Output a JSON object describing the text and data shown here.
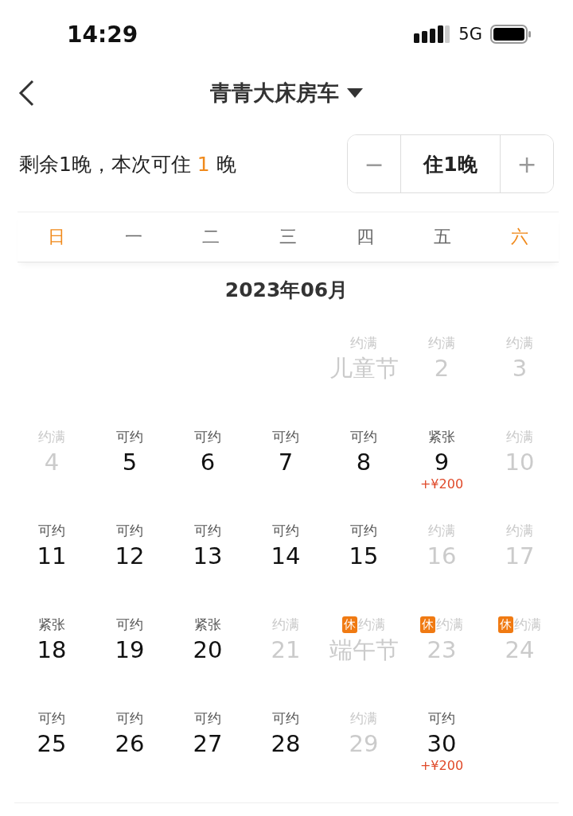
{
  "status_bar": {
    "time": "14:29",
    "network": "5G"
  },
  "nav": {
    "title": "青青大床房车"
  },
  "stay": {
    "prefix": "剩余1晚，本次可住",
    "count": "1",
    "suffix": "晚",
    "minus": "−",
    "value": "住1晚",
    "plus": "+"
  },
  "weekdays": [
    {
      "label": "日",
      "weekend": true
    },
    {
      "label": "一",
      "weekend": false
    },
    {
      "label": "二",
      "weekend": false
    },
    {
      "label": "三",
      "weekend": false
    },
    {
      "label": "四",
      "weekend": false
    },
    {
      "label": "五",
      "weekend": false
    },
    {
      "label": "六",
      "weekend": true
    }
  ],
  "month": {
    "title": "2023年06月",
    "days": [
      {
        "status": "约满",
        "date": "儿童节",
        "full": true
      },
      {
        "status": "约满",
        "date": "2",
        "full": true
      },
      {
        "status": "约满",
        "date": "3",
        "full": true
      },
      {
        "status": "约满",
        "date": "4",
        "full": true
      },
      {
        "status": "可约",
        "date": "5",
        "full": false
      },
      {
        "status": "可约",
        "date": "6",
        "full": false
      },
      {
        "status": "可约",
        "date": "7",
        "full": false
      },
      {
        "status": "可约",
        "date": "8",
        "full": false
      },
      {
        "status": "紧张",
        "date": "9",
        "full": false,
        "price": "+¥200"
      },
      {
        "status": "约满",
        "date": "10",
        "full": true
      },
      {
        "status": "可约",
        "date": "11",
        "full": false
      },
      {
        "status": "可约",
        "date": "12",
        "full": false
      },
      {
        "status": "可约",
        "date": "13",
        "full": false
      },
      {
        "status": "可约",
        "date": "14",
        "full": false
      },
      {
        "status": "可约",
        "date": "15",
        "full": false
      },
      {
        "status": "约满",
        "date": "16",
        "full": true
      },
      {
        "status": "约满",
        "date": "17",
        "full": true
      },
      {
        "status": "紧张",
        "date": "18",
        "full": false
      },
      {
        "status": "可约",
        "date": "19",
        "full": false
      },
      {
        "status": "紧张",
        "date": "20",
        "full": false
      },
      {
        "status": "约满",
        "date": "21",
        "full": true
      },
      {
        "status": "约满",
        "date": "端午节",
        "full": true,
        "rest_label": "休"
      },
      {
        "status": "约满",
        "date": "23",
        "full": true,
        "rest_label": "休"
      },
      {
        "status": "约满",
        "date": "24",
        "full": true,
        "rest_label": "休"
      },
      {
        "status": "可约",
        "date": "25",
        "full": false
      },
      {
        "status": "可约",
        "date": "26",
        "full": false
      },
      {
        "status": "可约",
        "date": "27",
        "full": false
      },
      {
        "status": "可约",
        "date": "28",
        "full": false
      },
      {
        "status": "约满",
        "date": "29",
        "full": true
      },
      {
        "status": "可约",
        "date": "30",
        "full": false,
        "price": "+¥200"
      }
    ]
  }
}
